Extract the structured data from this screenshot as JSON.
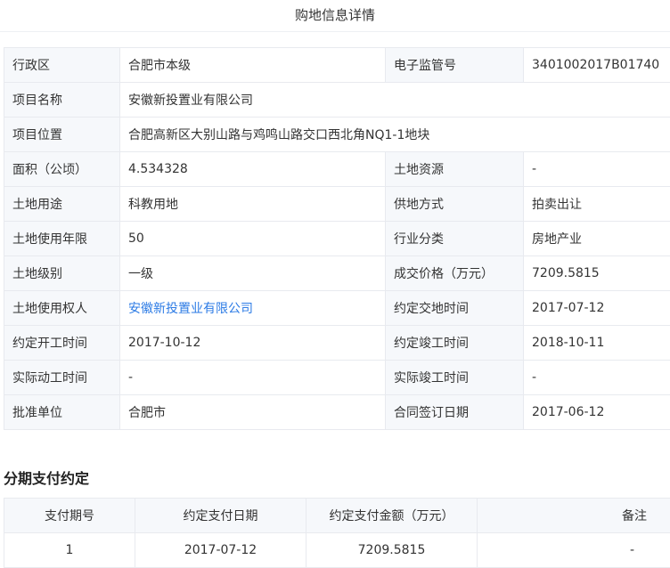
{
  "page": {
    "title": "购地信息详情"
  },
  "detail_rows": [
    [
      {
        "label": "行政区",
        "value": "合肥市本级"
      },
      {
        "label": "电子监管号",
        "value": "3401002017B01740"
      }
    ],
    [
      {
        "label": "项目名称",
        "value": "安徽新投置业有限公司"
      }
    ],
    [
      {
        "label": "项目位置",
        "value": "合肥高新区大别山路与鸡鸣山路交口西北角NQ1-1地块"
      }
    ],
    [
      {
        "label": "面积（公顷）",
        "value": "4.534328"
      },
      {
        "label": "土地资源",
        "value": "-"
      }
    ],
    [
      {
        "label": "土地用途",
        "value": "科教用地"
      },
      {
        "label": "供地方式",
        "value": "拍卖出让"
      }
    ],
    [
      {
        "label": "土地使用年限",
        "value": "50"
      },
      {
        "label": "行业分类",
        "value": "房地产业"
      }
    ],
    [
      {
        "label": "土地级别",
        "value": "一级"
      },
      {
        "label": "成交价格（万元）",
        "value": "7209.5815"
      }
    ],
    [
      {
        "label": "土地使用权人",
        "value": "安徽新投置业有限公司",
        "link": true
      },
      {
        "label": "约定交地时间",
        "value": "2017-07-12"
      }
    ],
    [
      {
        "label": "约定开工时间",
        "value": "2017-10-12"
      },
      {
        "label": "约定竣工时间",
        "value": "2018-10-11"
      }
    ],
    [
      {
        "label": "实际动工时间",
        "value": "-"
      },
      {
        "label": "实际竣工时间",
        "value": "-"
      }
    ],
    [
      {
        "label": "批准单位",
        "value": "合肥市"
      },
      {
        "label": "合同签订日期",
        "value": "2017-06-12"
      }
    ]
  ],
  "installments": {
    "title": "分期支付约定",
    "headers": [
      "支付期号",
      "约定支付日期",
      "约定支付金额（万元）",
      "备注"
    ],
    "rows": [
      [
        "1",
        "2017-07-12",
        "7209.5815",
        "-"
      ]
    ]
  }
}
